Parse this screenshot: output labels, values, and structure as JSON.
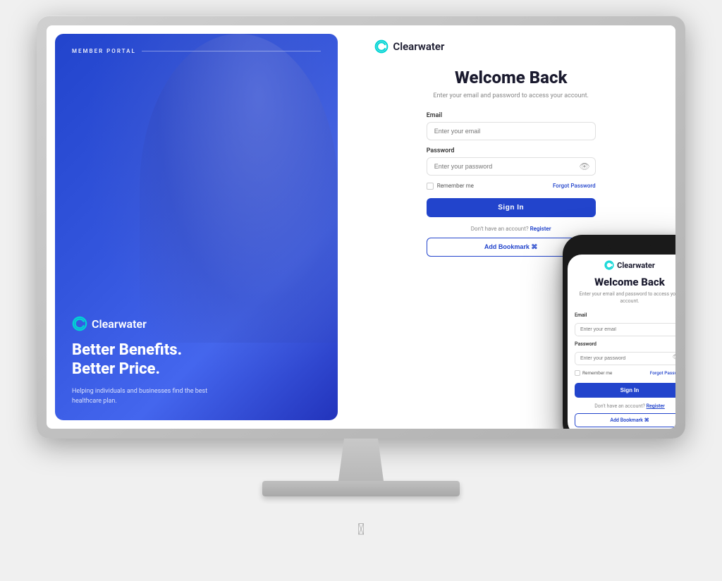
{
  "brand": {
    "name": "Clearwater",
    "logo_color": "#00c8c8"
  },
  "left_panel": {
    "member_portal_label": "MEMBER PORTAL",
    "tagline_line1": "Better Benefits.",
    "tagline_line2": "Better Price.",
    "sub_tagline": "Helping individuals and businesses find the best healthcare plan."
  },
  "login_form": {
    "welcome_title": "Welcome Back",
    "welcome_subtitle": "Enter your email and password to access your account.",
    "email_label": "Email",
    "email_placeholder": "Enter your email",
    "password_label": "Password",
    "password_placeholder": "Enter your password",
    "remember_me_label": "Remember me",
    "forgot_password_label": "Forgot Password",
    "sign_in_label": "Sign In",
    "no_account_text": "Don't have an account?",
    "register_label": "Register",
    "add_bookmark_label": "Add Bookmark ⌘"
  },
  "phone": {
    "welcome_title": "Welcome Back",
    "welcome_subtitle": "Enter your email and password to access your account.",
    "email_label": "Email",
    "email_placeholder": "Enter your email",
    "password_label": "Password",
    "password_placeholder": "Enter your password",
    "remember_me_label": "Remember me",
    "forgot_password_label": "Forgot Password",
    "sign_in_label": "Sign In",
    "no_account_text": "Don't have an account?",
    "register_label": "Register",
    "add_bookmark_label": "Add Bookmark ⌘"
  }
}
